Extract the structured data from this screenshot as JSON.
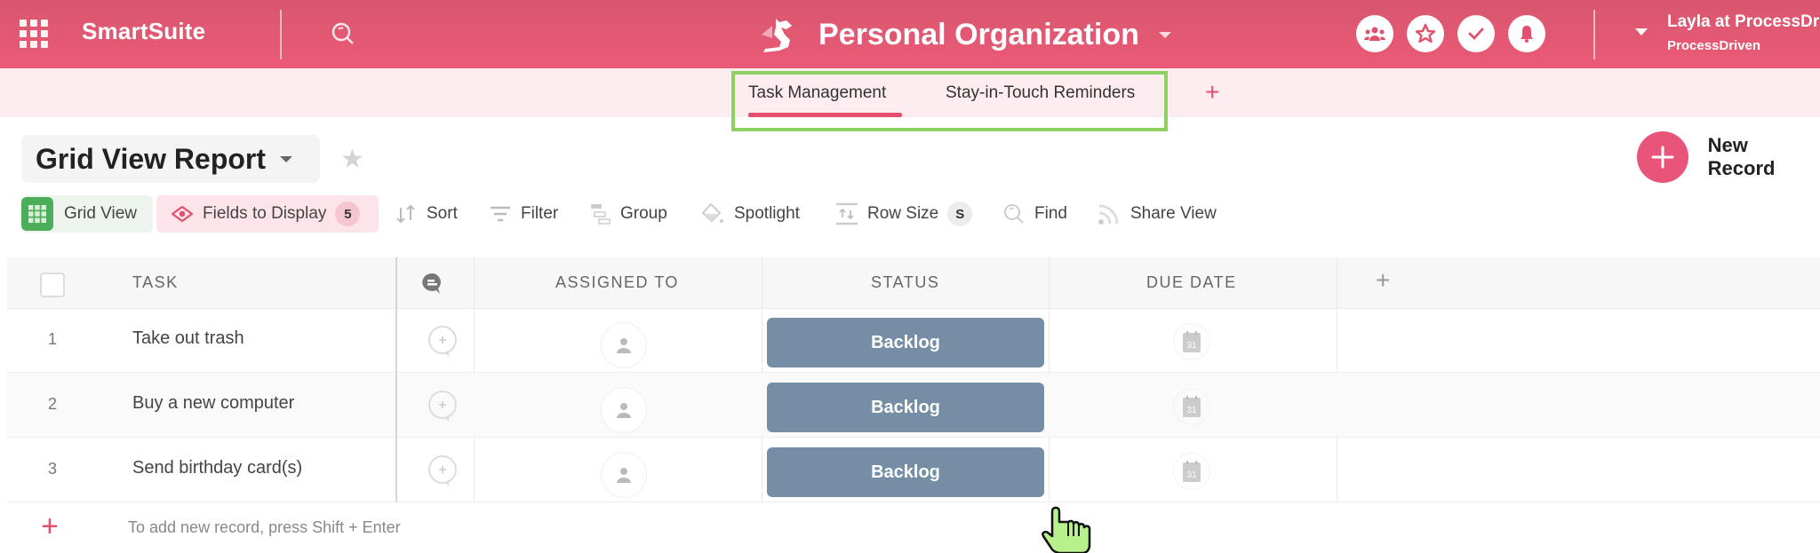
{
  "app": {
    "brand": "SmartSuite",
    "workspace_title": "Personal Organization",
    "user_name": "Layla at ProcessDr",
    "user_org": "ProcessDriven",
    "header_icons": [
      "team-icon",
      "star-icon",
      "check-icon",
      "bell-icon"
    ],
    "accent_color": "#e9557a"
  },
  "tabs": [
    {
      "label": "Task Management",
      "active": true
    },
    {
      "label": "Stay-in-Touch Reminders",
      "active": false
    }
  ],
  "tab_add_label": "+",
  "view": {
    "title": "Grid View Report",
    "new_record_label": "New Record"
  },
  "toolbar": {
    "grid_view": "Grid View",
    "fields_to_display": "Fields to Display",
    "fields_count": "5",
    "sort": "Sort",
    "filter": "Filter",
    "group": "Group",
    "spotlight": "Spotlight",
    "row_size": "Row Size",
    "row_size_value": "S",
    "find": "Find",
    "share_view": "Share View"
  },
  "grid": {
    "columns": {
      "task": "TASK",
      "assigned_to": "ASSIGNED TO",
      "status": "STATUS",
      "due_date": "DUE DATE",
      "add_column": "+"
    },
    "rows": [
      {
        "num": "1",
        "task": "Take out trash",
        "status": "Backlog"
      },
      {
        "num": "2",
        "task": "Buy a new computer",
        "status": "Backlog"
      },
      {
        "num": "3",
        "task": "Send birthday card(s)",
        "status": "Backlog"
      }
    ],
    "status_color": "#768ea5",
    "calendar_day": "31",
    "add_record_plus": "+",
    "add_record_hint": "To add new record, press Shift + Enter"
  }
}
